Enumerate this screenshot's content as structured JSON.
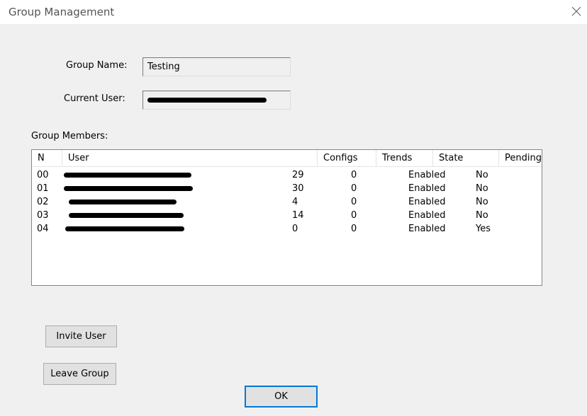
{
  "window": {
    "title": "Group Management"
  },
  "group_name": {
    "label": "Group Name:",
    "value": "Testing"
  },
  "current_user": {
    "label": "Current User:",
    "value": ""
  },
  "members": {
    "label": "Group Members:",
    "columns": [
      "N",
      "User",
      "Configs",
      "Trends",
      "State",
      "Pending"
    ],
    "rows": [
      {
        "n": "00",
        "configs": "29",
        "trends": "0",
        "state": "Enabled",
        "pending": "No"
      },
      {
        "n": "01",
        "configs": "30",
        "trends": "0",
        "state": "Enabled",
        "pending": "No"
      },
      {
        "n": "02",
        "configs": "4",
        "trends": "0",
        "state": "Enabled",
        "pending": "No"
      },
      {
        "n": "03",
        "configs": "14",
        "trends": "0",
        "state": "Enabled",
        "pending": "No"
      },
      {
        "n": "04",
        "configs": "0",
        "trends": "0",
        "state": "Enabled",
        "pending": "Yes"
      }
    ]
  },
  "buttons": {
    "invite": "Invite User",
    "leave": "Leave Group",
    "ok": "OK"
  }
}
